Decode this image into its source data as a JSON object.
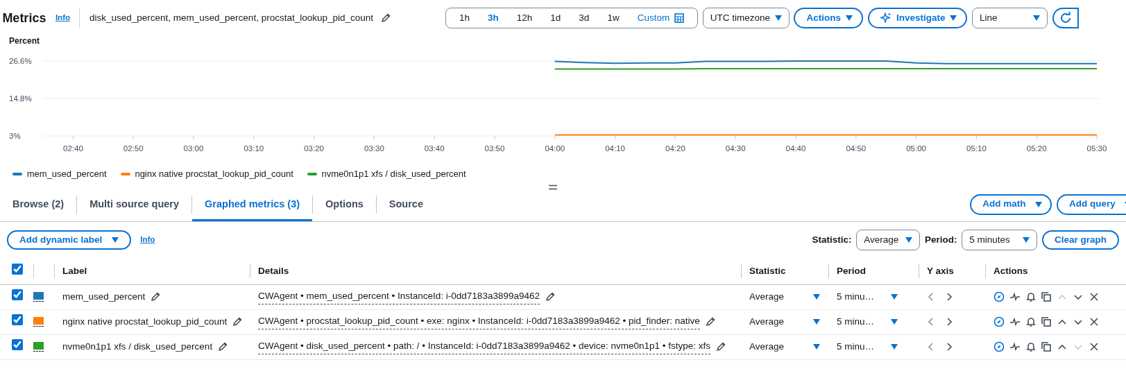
{
  "header": {
    "title": "Metrics",
    "info": "Info",
    "graph_title": "disk_used_percent, mem_used_percent, procstat_lookup_pid_count"
  },
  "time_ranges": [
    {
      "label": "1h",
      "kind": "preset",
      "selected": false
    },
    {
      "label": "3h",
      "kind": "preset",
      "selected": true
    },
    {
      "label": "12h",
      "kind": "preset",
      "selected": false
    },
    {
      "label": "1d",
      "kind": "preset",
      "selected": false
    },
    {
      "label": "3d",
      "kind": "preset",
      "selected": false
    },
    {
      "label": "1w",
      "kind": "preset",
      "selected": false
    },
    {
      "label": "Custom",
      "kind": "custom",
      "selected": false
    }
  ],
  "toolbar": {
    "timezone": "UTC timezone",
    "actions": "Actions",
    "investigate": "Investigate",
    "chart_type": "Line"
  },
  "chart": {
    "chart_data": {
      "type": "line",
      "ylabel": "Percent",
      "x": [
        240,
        245,
        250,
        255,
        260,
        265,
        270,
        275,
        280,
        285,
        290,
        295,
        300,
        305,
        310,
        315,
        320,
        325,
        330
      ],
      "xlim": [
        155,
        330
      ],
      "ylim": [
        3,
        26.6
      ],
      "xticks": [
        {
          "value": 160,
          "label": "02:40"
        },
        {
          "value": 170,
          "label": "02:50"
        },
        {
          "value": 180,
          "label": "03:00"
        },
        {
          "value": 190,
          "label": "03:10"
        },
        {
          "value": 200,
          "label": "03:20"
        },
        {
          "value": 210,
          "label": "03:30"
        },
        {
          "value": 220,
          "label": "03:40"
        },
        {
          "value": 230,
          "label": "03:50"
        },
        {
          "value": 240,
          "label": "04:00"
        },
        {
          "value": 250,
          "label": "04:10"
        },
        {
          "value": 260,
          "label": "04:20"
        },
        {
          "value": 270,
          "label": "04:30"
        },
        {
          "value": 280,
          "label": "04:40"
        },
        {
          "value": 290,
          "label": "04:50"
        },
        {
          "value": 300,
          "label": "05:00"
        },
        {
          "value": 310,
          "label": "05:10"
        },
        {
          "value": 320,
          "label": "05:20"
        },
        {
          "value": 330,
          "label": "05:30"
        }
      ],
      "yticks": [
        {
          "value": 3,
          "label": "3%"
        },
        {
          "value": 14.8,
          "label": "14.8%"
        },
        {
          "value": 26.6,
          "label": "26.6%"
        }
      ],
      "series": [
        {
          "name": "mem_used_percent",
          "color": "#1f77b4",
          "values": [
            26.5,
            26.1,
            25.9,
            26.0,
            26.0,
            26.5,
            26.5,
            26.5,
            26.6,
            26.6,
            26.6,
            26.6,
            26.0,
            25.8,
            25.8,
            25.8,
            25.8,
            25.8,
            25.8
          ]
        },
        {
          "name": "nginx native procstat_lookup_pid_count",
          "color": "#ff7f0e",
          "values": [
            3.3,
            3.3,
            3.3,
            3.3,
            3.3,
            3.3,
            3.3,
            3.3,
            3.3,
            3.3,
            3.3,
            3.3,
            3.3,
            3.3,
            3.3,
            3.3,
            3.3,
            3.3,
            3.3
          ]
        },
        {
          "name": "nvme0n1p1 xfs / disk_used_percent",
          "color": "#2ca02c",
          "values": [
            24.1,
            24.1,
            24.1,
            24.1,
            24.1,
            24.2,
            24.2,
            24.2,
            24.2,
            24.2,
            24.2,
            24.2,
            24.2,
            24.2,
            24.2,
            24.2,
            24.2,
            24.2,
            24.2
          ]
        }
      ]
    }
  },
  "tabs": [
    {
      "label": "Browse (2)",
      "selected": false
    },
    {
      "label": "Multi source query",
      "selected": false
    },
    {
      "label": "Graphed metrics (3)",
      "selected": true
    },
    {
      "label": "Options",
      "selected": false
    },
    {
      "label": "Source",
      "selected": false
    }
  ],
  "tab_actions": [
    "Add math",
    "Add query"
  ],
  "graph_toolbar": {
    "dynamic_label": "Add dynamic label",
    "info": "Info",
    "statistic_label": "Statistic:",
    "statistic": "Average",
    "period_label": "Period:",
    "period": "5 minutes",
    "clear": "Clear graph"
  },
  "table": {
    "all_checked": true,
    "columns": [
      "Label",
      "Details",
      "Statistic",
      "Period",
      "Y axis",
      "Actions"
    ],
    "rows": [
      {
        "checked": true,
        "color": "#1f77b4",
        "label": "mem_used_percent",
        "details": "CWAgent • mem_used_percent • InstanceId: i-0dd7183a3899a9462",
        "statistic": "Average",
        "period": "5 minu…",
        "move_up_disabled": true,
        "move_down_disabled": false
      },
      {
        "checked": true,
        "color": "#ff7f0e",
        "label": "nginx native procstat_lookup_pid_count",
        "details": "CWAgent • procstat_lookup_pid_count • exe: nginx • InstanceId: i-0dd7183a3899a9462 • pid_finder: native",
        "statistic": "Average",
        "period": "5 minu…",
        "move_up_disabled": false,
        "move_down_disabled": false
      },
      {
        "checked": true,
        "color": "#2ca02c",
        "label": "nvme0n1p1 xfs / disk_used_percent",
        "details": "CWAgent • disk_used_percent • path: / • InstanceId: i-0dd7183a3899a9462 • device: nvme0n1p1 • fstype: xfs",
        "statistic": "Average",
        "period": "5 minu…",
        "move_up_disabled": false,
        "move_down_disabled": true
      }
    ]
  }
}
